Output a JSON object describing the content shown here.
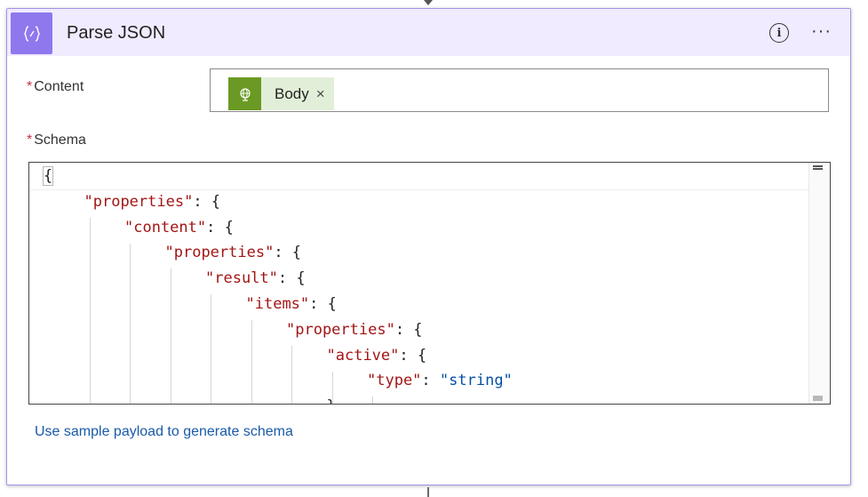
{
  "action": {
    "title": "Parse JSON",
    "icon": "curly-braces-icon",
    "accent_color": "#8f78ee",
    "header_bg": "#f0ebff",
    "info_label": "i",
    "more_label": "···"
  },
  "content_field": {
    "label": "Content",
    "required_mark": "*",
    "token": {
      "label": "Body",
      "remove_label": "×",
      "icon": "globe-icon",
      "color": "#6a9a24"
    }
  },
  "schema_field": {
    "label": "Schema",
    "required_mark": "*",
    "lines": [
      {
        "indent": 0,
        "brace": "{"
      },
      {
        "indent": 1,
        "key": "\"properties\"",
        "rest": ": {"
      },
      {
        "indent": 2,
        "key": "\"content\"",
        "rest": ": {"
      },
      {
        "indent": 3,
        "key": "\"properties\"",
        "rest": ": {"
      },
      {
        "indent": 4,
        "key": "\"result\"",
        "rest": ": {"
      },
      {
        "indent": 5,
        "key": "\"items\"",
        "rest": ": {"
      },
      {
        "indent": 6,
        "key": "\"properties\"",
        "rest": ": {"
      },
      {
        "indent": 7,
        "key": "\"active\"",
        "rest": ": {"
      },
      {
        "indent": 8,
        "key": "\"type\"",
        "rest": ": ",
        "value": "\"string\""
      },
      {
        "indent": 7,
        "rest": "},"
      }
    ]
  },
  "sample_link": "Use sample payload to generate schema"
}
